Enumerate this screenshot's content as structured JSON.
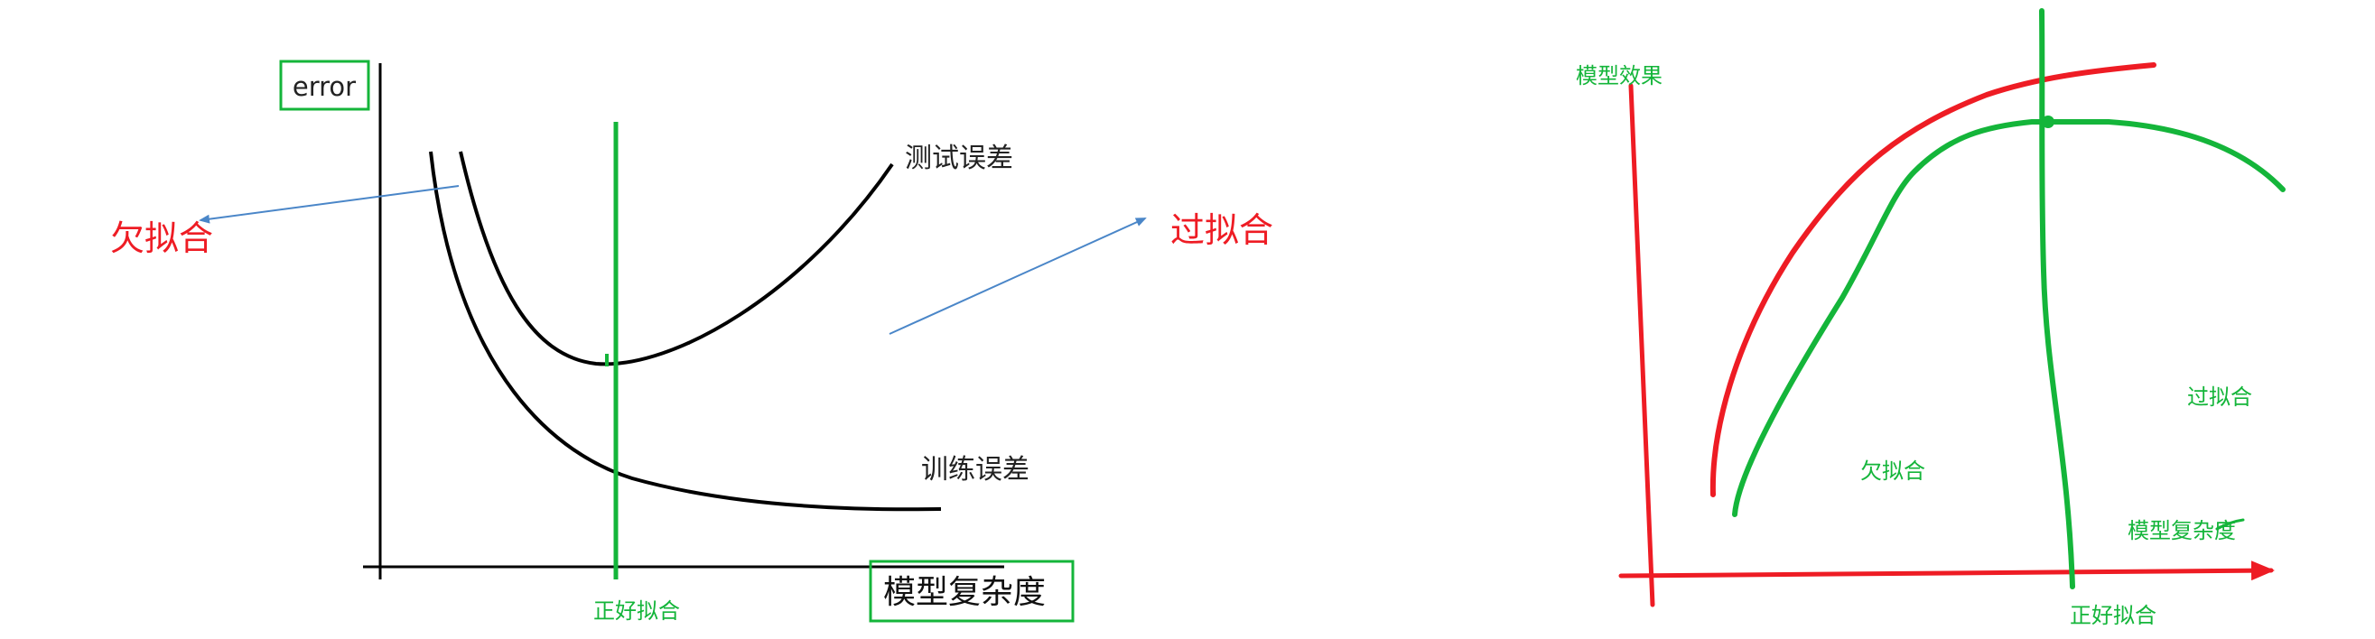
{
  "left_diagram": {
    "y_axis_label": "error",
    "x_axis_label": "模型复杂度",
    "test_curve_label": "测试误差",
    "train_curve_label": "训练误差",
    "underfit_label": "欠拟合",
    "overfit_label": "过拟合",
    "good_fit_label": "正好拟合"
  },
  "right_diagram": {
    "y_axis_label": "模型效果",
    "x_axis_label": "模型复杂度",
    "underfit_label": "欠拟合",
    "overfit_label": "过拟合",
    "good_fit_label": "正好拟合"
  },
  "colors": {
    "axis": "#000000",
    "curve": "#000000",
    "green": "#14b53a",
    "red": "#ee1c24",
    "arrow_blue": "#4a86c8"
  }
}
